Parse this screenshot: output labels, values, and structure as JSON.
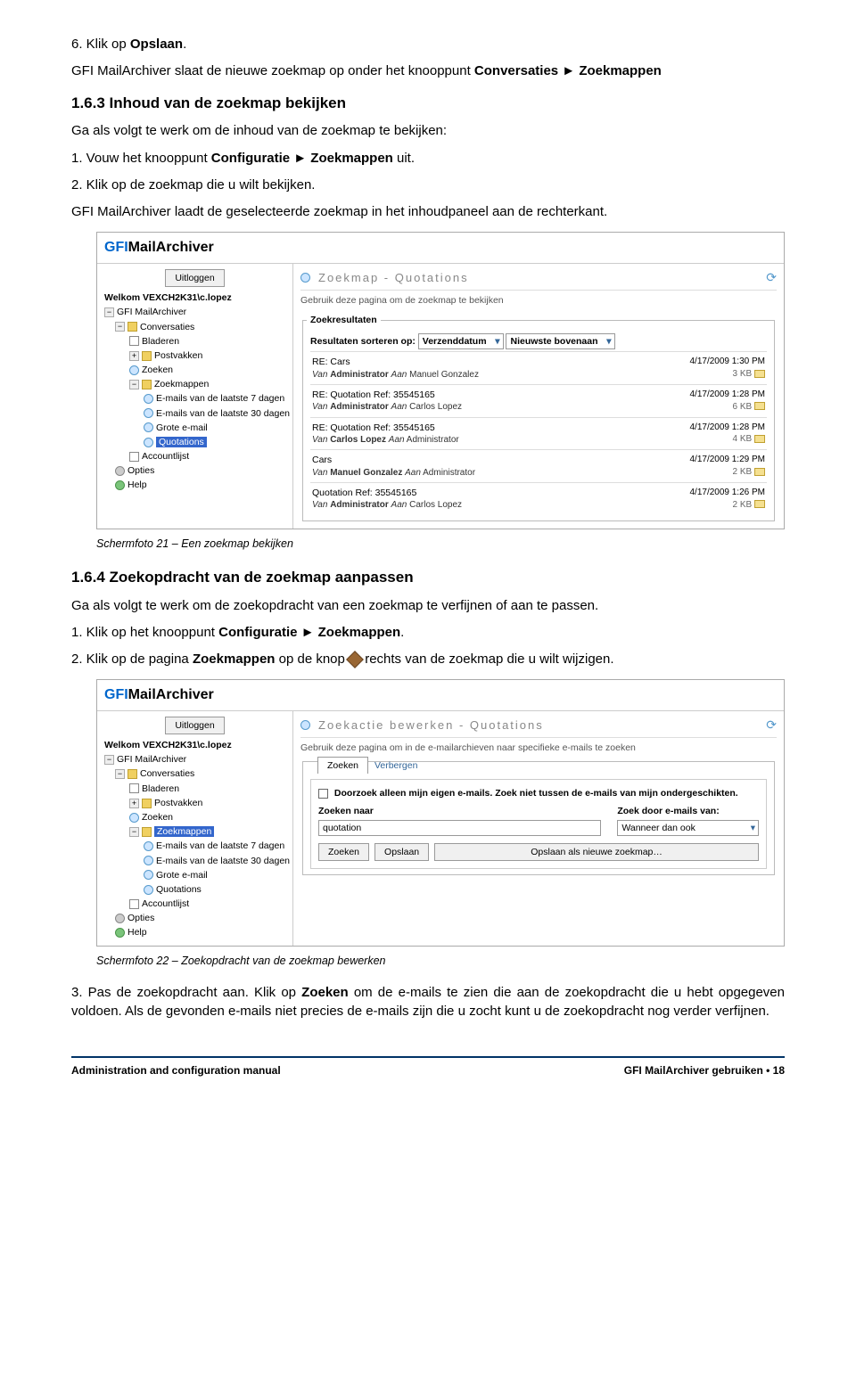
{
  "doc": {
    "step6": "6. Klik op ",
    "opslaan": "Opslaan",
    "period": ".",
    "after_step6": "GFI MailArchiver slaat de nieuwe zoekmap op onder het knooppunt ",
    "conv_zoek": "Conversaties ► Zoekmappen",
    "h163": "1.6.3  Inhoud van de zoekmap bekijken",
    "p163_intro": "Ga als volgt te werk om de inhoud van de zoekmap te bekijken:",
    "p163_1a": "1. Vouw het knooppunt ",
    "p163_1b": "Configuratie ► Zoekmappen",
    "p163_1c": " uit.",
    "p163_2": "2. Klik op de zoekmap die u wilt bekijken.",
    "p163_after": "GFI MailArchiver laadt de geselecteerde zoekmap in het inhoudpaneel aan de rechterkant.",
    "caption21": "Schermfoto 21 – Een zoekmap bekijken",
    "h164": "1.6.4  Zoekopdracht van de zoekmap aanpassen",
    "p164_intro": "Ga als volgt te werk om de zoekopdracht van een zoekmap te verfijnen of aan te passen.",
    "p164_1a": "1. Klik op het knooppunt ",
    "p164_1b": "Configuratie ► Zoekmappen",
    "p164_1c": ".",
    "p164_2a": "2. Klik op de pagina ",
    "p164_2b": "Zoekmappen",
    "p164_2c": " op de knop ",
    "p164_2d": " rechts van de zoekmap die u wilt wijzigen.",
    "caption22": "Schermfoto 22 – Zoekopdracht van de zoekmap bewerken",
    "p3a": "3. Pas de zoekopdracht aan. Klik op ",
    "p3b": "Zoeken",
    "p3c": " om de e-mails te zien die aan de zoekopdracht die u hebt opgegeven voldoen. Als de gevonden e-mails niet precies de e-mails zijn die u zocht kunt u de zoekopdracht nog verder verfijnen.",
    "footer_left": "Administration and configuration manual",
    "footer_right": "GFI MailArchiver gebruiken • 18"
  },
  "app": {
    "logo_gfi": "GFI",
    "logo_mail": "MailArchiver",
    "uitloggen": "Uitloggen",
    "welkom": "Welkom VEXCH2K31\\c.lopez",
    "tree": {
      "root": "GFI MailArchiver",
      "conversaties": "Conversaties",
      "bladeren": "Bladeren",
      "postvakken": "Postvakken",
      "zoeken": "Zoeken",
      "zoekmappen": "Zoekmappen",
      "emails7": "E-mails van de laatste 7 dagen",
      "emails30": "E-mails van de laatste 30 dagen",
      "grote": "Grote e-mail",
      "quotations": "Quotations",
      "accountlijst": "Accountlijst",
      "opties": "Opties",
      "help": "Help"
    }
  },
  "screen1": {
    "title": "Zoekmap - Quotations",
    "subtext": "Gebruik deze pagina om de zoekmap te bekijken",
    "zoekresultaten": "Zoekresultaten",
    "sort_label": "Resultaten sorteren op:",
    "sort_val": "Verzenddatum",
    "sort_order": "Nieuwste bovenaan",
    "rows": [
      {
        "subj": "RE: Cars",
        "from": "Administrator",
        "to": "Manuel Gonzalez",
        "date": "4/17/2009 1:30 PM",
        "size": "3 KB"
      },
      {
        "subj": "RE: Quotation Ref: 35545165",
        "from": "Administrator",
        "to": "Carlos Lopez",
        "date": "4/17/2009 1:28 PM",
        "size": "6 KB"
      },
      {
        "subj": "RE: Quotation Ref: 35545165",
        "from": "Carlos Lopez",
        "to": "Administrator",
        "date": "4/17/2009 1:28 PM",
        "size": "4 KB"
      },
      {
        "subj": "Cars",
        "from": "Manuel Gonzalez",
        "to": "Administrator",
        "date": "4/17/2009 1:29 PM",
        "size": "2 KB"
      },
      {
        "subj": "Quotation Ref: 35545165",
        "from": "Administrator",
        "to": "Carlos Lopez",
        "date": "4/17/2009 1:26 PM",
        "size": "2 KB"
      }
    ],
    "van": "Van",
    "aan": "Aan"
  },
  "screen2": {
    "title": "Zoekactie bewerken - Quotations",
    "subtext": "Gebruik deze pagina om in de e-mailarchieven naar specifieke e-mails te zoeken",
    "zoeken_tab": "Zoeken",
    "verbergen": "Verbergen",
    "checkbox_text": "Doorzoek alleen mijn eigen e-mails. Zoek niet tussen de e-mails van mijn ondergeschikten.",
    "zoeken_naar": "Zoeken naar",
    "zoek_door": "Zoek door e-mails van:",
    "quotation_val": "quotation",
    "wanneer": "Wanneer dan ook",
    "btn_zoeken": "Zoeken",
    "btn_opslaan": "Opslaan",
    "btn_opslaan_als": "Opslaan als nieuwe zoekmap…"
  }
}
